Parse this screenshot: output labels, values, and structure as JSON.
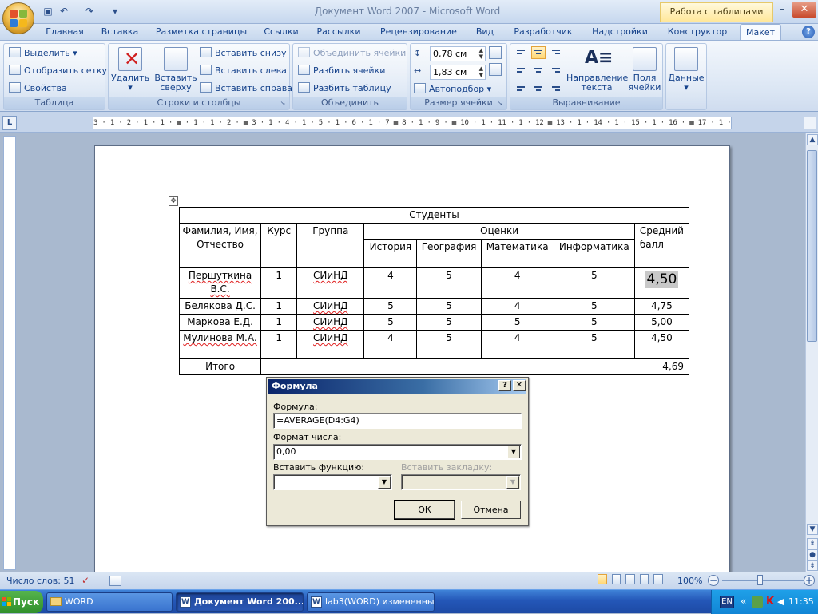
{
  "window": {
    "title": "Документ Word 2007 - Microsoft Word",
    "context_tab_title": "Работа с таблицами",
    "minimize": "–",
    "restore": "❐",
    "close": "✕"
  },
  "quick_access": {
    "save_icon": "floppy-icon",
    "undo": "↶",
    "redo": "↷",
    "customize": "▾"
  },
  "tabs": [
    "Главная",
    "Вставка",
    "Разметка страницы",
    "Ссылки",
    "Рассылки",
    "Рецензирование",
    "Вид",
    "Разработчик",
    "Надстройки",
    "Конструктор",
    "Макет"
  ],
  "active_tab": "Макет",
  "help": "?",
  "ribbon": {
    "table": {
      "label": "Таблица",
      "select": "Выделить ▾",
      "show_grid": "Отобразить сетку",
      "properties": "Свойства"
    },
    "rows_cols": {
      "label": "Строки и столбцы",
      "delete": "Удалить",
      "insert_above": "Вставить сверху",
      "insert_below": "Вставить снизу",
      "insert_left": "Вставить слева",
      "insert_right": "Вставить справа"
    },
    "merge": {
      "label": "Объединить",
      "merge_cells": "Объединить ячейки",
      "split_cells": "Разбить ячейки",
      "split_table": "Разбить таблицу"
    },
    "cell_size": {
      "label": "Размер ячейки",
      "height": "0,78 см",
      "width": "1,83 см",
      "autofit": "Автоподбор ▾"
    },
    "alignment": {
      "label": "Выравнивание",
      "text_direction": "Направление текста",
      "cell_margins": "Поля ячейки"
    },
    "data": {
      "label": "Данные"
    }
  },
  "ruler": {
    "corner": "L",
    "text": "3 · 1 · 2 · 1 · 1 · ▦ · 1 · 1 · 2 · ▦ 3 · 1 · 4 · 1 · 5 · 1 · 6 · 1 · 7 ▦ 8 · 1 · 9 · ▦ 10 · 1 · 11 · 1 · 12 ▦ 13 · 1 · 14 · 1 · 15 · 1 · 16 · ▦ 17 · 1 · 18"
  },
  "table": {
    "caption": "Студенты",
    "headers": {
      "name": "Фамилия, Имя, Отчество",
      "course": "Курс",
      "group": "Группа",
      "grades": "Оценки",
      "avg": "Средний балл"
    },
    "subjects": [
      "История",
      "География",
      "Математика",
      "Информатика"
    ],
    "rows": [
      {
        "name": "Першуткина В.С.",
        "course": "1",
        "group": "СИиНД",
        "grades": [
          "4",
          "5",
          "4",
          "5"
        ],
        "avg": "4,50"
      },
      {
        "name": "Белякова Д.С.",
        "course": "1",
        "group": "СИиНД",
        "grades": [
          "5",
          "5",
          "4",
          "5"
        ],
        "avg": "4,75"
      },
      {
        "name": "Маркова Е.Д.",
        "course": "1",
        "group": "СИиНД",
        "grades": [
          "5",
          "5",
          "5",
          "5"
        ],
        "avg": "5,00"
      },
      {
        "name": "Мулинова М.А.",
        "course": "1",
        "group": "СИиНД",
        "grades": [
          "4",
          "5",
          "4",
          "5"
        ],
        "avg": "4,50"
      }
    ],
    "total_label": "Итого",
    "total_value": "4,69"
  },
  "dialog": {
    "title": "Формула",
    "help": "?",
    "close": "✕",
    "formula_label": "Формула:",
    "formula_value": "=AVERAGE(D4:G4)",
    "number_format_label": "Формат числа:",
    "number_format_value": "0,00",
    "insert_function_label": "Вставить функцию:",
    "insert_bookmark_label": "Вставить закладку:",
    "ok": "ОК",
    "cancel": "Отмена"
  },
  "status": {
    "word_count": "Число слов: 51",
    "zoom": "100%"
  },
  "taskbar": {
    "start": "Пуск",
    "items": [
      "WORD",
      "Документ Word 200...",
      "lab3(WORD) измененны..."
    ],
    "lang": "EN",
    "tray_chevron": "«",
    "time": "11:35"
  },
  "colors": {
    "accent": "#15428b",
    "ribbon_bg": "#dbe6f4",
    "taskbar": "#2457b8",
    "dialog_title": "#0a246a",
    "highlight": "#c8c8c8"
  }
}
